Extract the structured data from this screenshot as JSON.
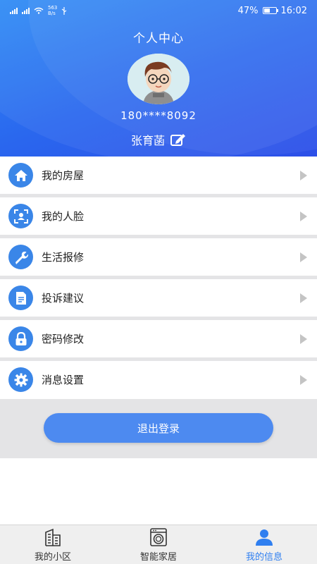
{
  "status_bar": {
    "net_speed": "563\nB/s",
    "battery_percent": "47%",
    "time": "16:02"
  },
  "header": {
    "title": "个人中心",
    "phone": "180****8092",
    "username": "张育菡"
  },
  "menu": [
    {
      "label": "我的房屋",
      "icon": "home-icon"
    },
    {
      "label": "我的人脸",
      "icon": "face-icon"
    },
    {
      "label": "生活报修",
      "icon": "wrench-icon"
    },
    {
      "label": "投诉建议",
      "icon": "document-icon"
    },
    {
      "label": "密码修改",
      "icon": "lock-icon"
    },
    {
      "label": "消息设置",
      "icon": "gear-icon"
    }
  ],
  "logout_label": "退出登录",
  "bottom_nav": [
    {
      "label": "我的小区",
      "icon": "building-icon",
      "active": false
    },
    {
      "label": "智能家居",
      "icon": "washer-icon",
      "active": false
    },
    {
      "label": "我的信息",
      "icon": "person-icon",
      "active": true
    }
  ],
  "colors": {
    "accent": "#2f7ff0",
    "menu_icon_bg": "#3a86e8",
    "logout_button": "#4d8af0",
    "separator": "#e4e4e6"
  }
}
